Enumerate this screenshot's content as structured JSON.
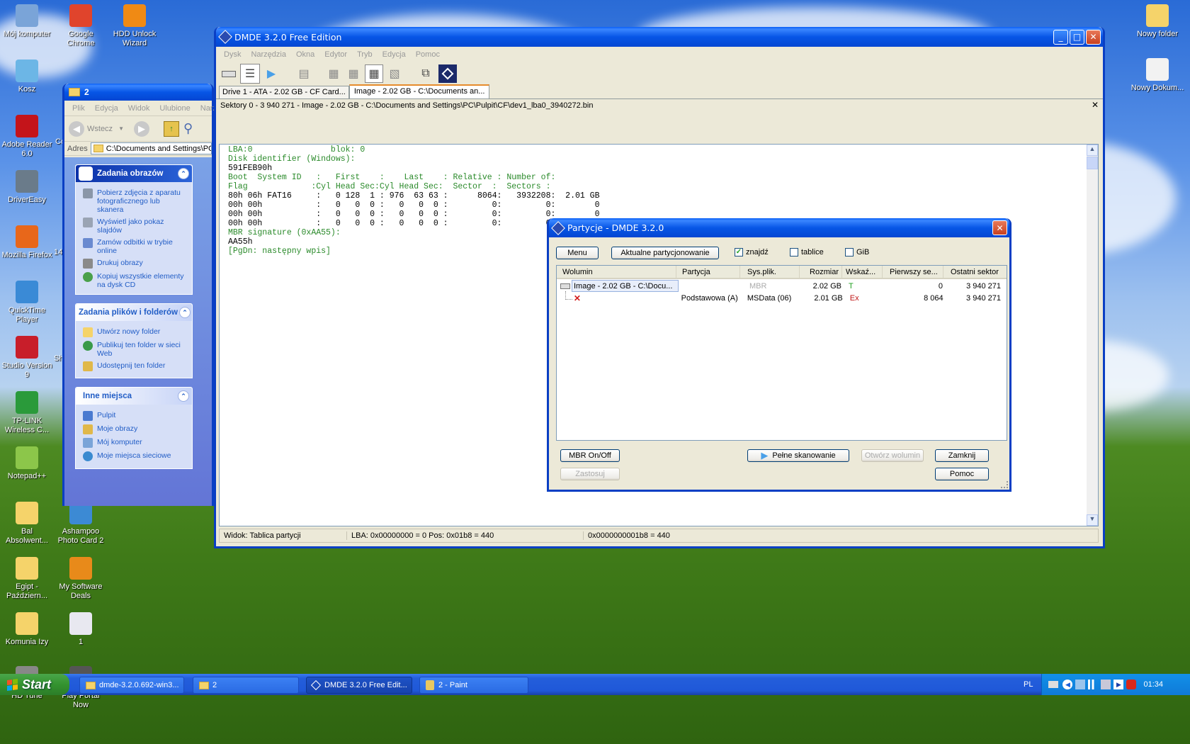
{
  "desktop": {
    "icons_left": [
      {
        "label": "Mój komputer",
        "icon": "computer-icon",
        "color": "#7aa4d8"
      },
      {
        "label": "Google Chrome",
        "icon": "chrome-icon",
        "color": "#e0442c"
      },
      {
        "label": "HDD Unlock Wizard",
        "icon": "hdd-unlock-icon",
        "color": "#f08a14"
      },
      {
        "label": "Kosz",
        "icon": "recycle-bin-icon",
        "color": "#6cb6e6"
      },
      {
        "label": "Adobe Reader 6.0",
        "icon": "adobe-reader-icon",
        "color": "#c4141a"
      },
      {
        "label": "DriverEasy",
        "icon": "drivereasy-icon",
        "color": "#6a7b8a"
      },
      {
        "label": "Mozilla Firefox",
        "icon": "firefox-icon",
        "color": "#e8671a"
      },
      {
        "label": "QuickTime Player",
        "icon": "quicktime-icon",
        "color": "#3a8ad6"
      },
      {
        "label": "Studio Version 9",
        "icon": "studio-icon",
        "color": "#c81e2a"
      },
      {
        "label": "TP-LINK Wireless C...",
        "icon": "tplink-icon",
        "color": "#2a9a3a"
      },
      {
        "label": "Notepad++",
        "icon": "notepad-icon",
        "color": "#8cc64a"
      },
      {
        "label": "Bal Absolwent...",
        "icon": "folder-icon",
        "color": "#f5d36a"
      },
      {
        "label": "Ashampoo Photo Card 2",
        "icon": "ashampoo-icon",
        "color": "#3c8ad4"
      },
      {
        "label": "Egipt - Październ...",
        "icon": "folder-icon",
        "color": "#f5d36a"
      },
      {
        "label": "My Software Deals",
        "icon": "cart-icon",
        "color": "#e88a1a"
      },
      {
        "label": "Komunia Izy",
        "icon": "folder-icon",
        "color": "#f5d36a"
      },
      {
        "label": "1",
        "icon": "document-icon",
        "color": "#e8e8f0"
      },
      {
        "label": "HD Tune",
        "icon": "hdtune-icon",
        "color": "#888888"
      },
      {
        "label": "Play Portal Now",
        "icon": "playportal-icon",
        "color": "#555555"
      }
    ],
    "icons_right": [
      {
        "label": "Nowy folder",
        "icon": "folder-icon"
      },
      {
        "label": "Nowy Dokum...",
        "icon": "document-icon"
      }
    ],
    "partial_labels": [
      "Co",
      "G",
      "14",
      "Sh"
    ]
  },
  "explorer": {
    "title": "2",
    "menu": [
      "Plik",
      "Edycja",
      "Widok",
      "Ulubione",
      "Narz"
    ],
    "back_label": "Wstecz",
    "address_label": "Adres",
    "address_value": "C:\\Documents and Settings\\PC\\",
    "sections": [
      {
        "title": "Zadania obrazów",
        "items": [
          "Pobierz zdjęcia z aparatu fotograficznego lub skanera",
          "Wyświetl jako pokaz slajdów",
          "Zamów odbitki w trybie online",
          "Drukuj obrazy",
          "Kopiuj wszystkie elementy na dysk CD"
        ]
      },
      {
        "title": "Zadania plików i folderów",
        "items": [
          "Utwórz nowy folder",
          "Publikuj ten folder w sieci Web",
          "Udostępnij ten folder"
        ]
      },
      {
        "title": "Inne miejsca",
        "items": [
          "Pulpit",
          "Moje obrazy",
          "Mój komputer",
          "Moje miejsca sieciowe"
        ]
      }
    ]
  },
  "dmde": {
    "title": "DMDE 3.2.0 Free Edition",
    "menu": [
      "Dysk",
      "Narzędzia",
      "Okna",
      "Edytor",
      "Tryb",
      "Edycja",
      "Pomoc"
    ],
    "tabs": [
      "Drive 1 - ATA - 2.02 GB - CF Card...",
      "Image - 2.02 GB - C:\\Documents an..."
    ],
    "sector_bar": "Sektory 0 - 3 940 271 - Image - 2.02 GB - C:\\Documents and Settings\\PC\\Pulpit\\CF\\dev1_lba0_3940272.bin",
    "hex_lines": [
      "LBA:0                blok: 0",
      "Disk identifier (Windows):",
      "591FEB90h",
      "Boot  System ID   :   First    :    Last    : Relative : Number of:",
      "Flag             :Cyl Head Sec:Cyl Head Sec:  Sector  :  Sectors :",
      "80h 06h FAT16     :   0 128  1 : 976  63 63 :      8064:   3932208:  2.01 GB",
      "00h 00h           :   0   0  0 :   0   0  0 :         0:         0:        0",
      "00h 00h           :   0   0  0 :   0   0  0 :         0:         0:        0",
      "00h 00h           :   0   0  0 :   0   0  0 :         0:         0:        0",
      "MBR signature (0xAA55):",
      "AA55h",
      "[PgDn: następny wpis]"
    ],
    "status": {
      "view": "Widok:  Tablica partycji",
      "lba": "LBA: 0x00000000 = 0  Pos: 0x01b8 = 440",
      "hex": "0x0000000001b8 = 440"
    }
  },
  "partitions_dialog": {
    "title": "Partycje - DMDE 3.2.0",
    "buttons": {
      "menu": "Menu",
      "current": "Aktualne partycjonowanie",
      "mbr": "MBR On/Off",
      "apply": "Zastosuj",
      "full_scan": "Pełne skanowanie",
      "open_volume": "Otwórz wolumin",
      "close": "Zamknij",
      "help": "Pomoc"
    },
    "checkboxes": [
      {
        "label": "znajdź",
        "checked": true
      },
      {
        "label": "tablice",
        "checked": false
      },
      {
        "label": "GiB",
        "checked": false
      }
    ],
    "columns": [
      "Wolumin",
      "Partycja",
      "Sys.plik.",
      "Rozmiar",
      "Wskaź...",
      "Pierwszy se...",
      "Ostatni sektor"
    ],
    "rows": [
      {
        "volume": "Image - 2.02 GB - C:\\Docu...",
        "partition": "",
        "fs": "MBR",
        "size": "2.02 GB",
        "ind": "T",
        "first": "0",
        "last": "3 940 271"
      },
      {
        "volume": "",
        "partition": "Podstawowa (A)",
        "fs": "MSData (06)",
        "size": "2.01 GB",
        "ind": "Ex",
        "first": "8 064",
        "last": "3 940 271"
      }
    ]
  },
  "taskbar": {
    "start": "Start",
    "tasks": [
      "dmde-3.2.0.692-win3...",
      "2",
      "DMDE 3.2.0 Free Edit...",
      "2 - Paint"
    ],
    "lang": "PL",
    "clock": "01:34"
  }
}
